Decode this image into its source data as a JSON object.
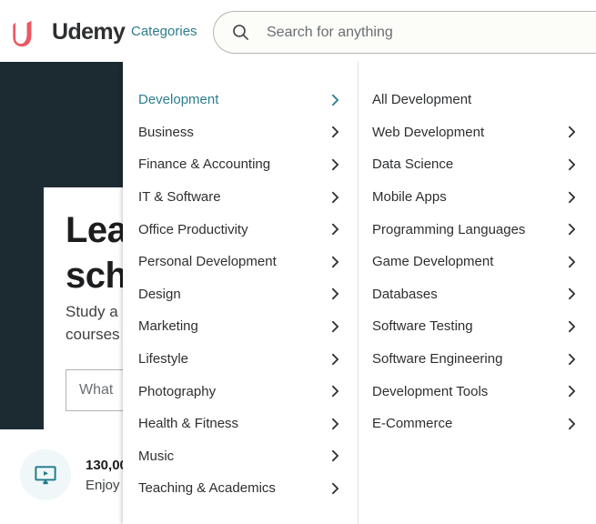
{
  "header": {
    "logo_text": "Udemy",
    "logo_icon": "udemy-u-logo",
    "categories_label": "Categories",
    "search": {
      "icon": "search-icon",
      "placeholder": "Search for anything",
      "value": ""
    }
  },
  "hero": {
    "title": "Lea\nsch",
    "title_line1": "Lea",
    "title_line2": "sch",
    "sub_line1": "Study a",
    "sub_line2": "courses",
    "input_value": "What "
  },
  "stats": {
    "icon": "video-monitor-icon",
    "number": "130,00",
    "description": "Enjoy a"
  },
  "dropdown": {
    "column1": [
      {
        "label": "Development",
        "active": true,
        "has_chevron": true
      },
      {
        "label": "Business",
        "active": false,
        "has_chevron": true
      },
      {
        "label": "Finance & Accounting",
        "active": false,
        "has_chevron": true
      },
      {
        "label": "IT & Software",
        "active": false,
        "has_chevron": true
      },
      {
        "label": "Office Productivity",
        "active": false,
        "has_chevron": true
      },
      {
        "label": "Personal Development",
        "active": false,
        "has_chevron": true
      },
      {
        "label": "Design",
        "active": false,
        "has_chevron": true
      },
      {
        "label": "Marketing",
        "active": false,
        "has_chevron": true
      },
      {
        "label": "Lifestyle",
        "active": false,
        "has_chevron": true
      },
      {
        "label": "Photography",
        "active": false,
        "has_chevron": true
      },
      {
        "label": "Health & Fitness",
        "active": false,
        "has_chevron": true
      },
      {
        "label": "Music",
        "active": false,
        "has_chevron": true
      },
      {
        "label": "Teaching & Academics",
        "active": false,
        "has_chevron": true
      }
    ],
    "column2": [
      {
        "label": "All Development",
        "active": false,
        "has_chevron": false
      },
      {
        "label": "Web Development",
        "active": false,
        "has_chevron": true
      },
      {
        "label": "Data Science",
        "active": false,
        "has_chevron": true
      },
      {
        "label": "Mobile Apps",
        "active": false,
        "has_chevron": true
      },
      {
        "label": "Programming Languages",
        "active": false,
        "has_chevron": true
      },
      {
        "label": "Game Development",
        "active": false,
        "has_chevron": true
      },
      {
        "label": "Databases",
        "active": false,
        "has_chevron": true
      },
      {
        "label": "Software Testing",
        "active": false,
        "has_chevron": true
      },
      {
        "label": "Software Engineering",
        "active": false,
        "has_chevron": true
      },
      {
        "label": "Development Tools",
        "active": false,
        "has_chevron": true
      },
      {
        "label": "E-Commerce",
        "active": false,
        "has_chevron": true
      }
    ]
  },
  "colors": {
    "accent_teal": "#2d7d8f",
    "logo_red": "#eb5763",
    "hero_dark": "#1c2b32",
    "text_primary": "#2d2f31",
    "bubble_bg": "#eff7f8"
  }
}
